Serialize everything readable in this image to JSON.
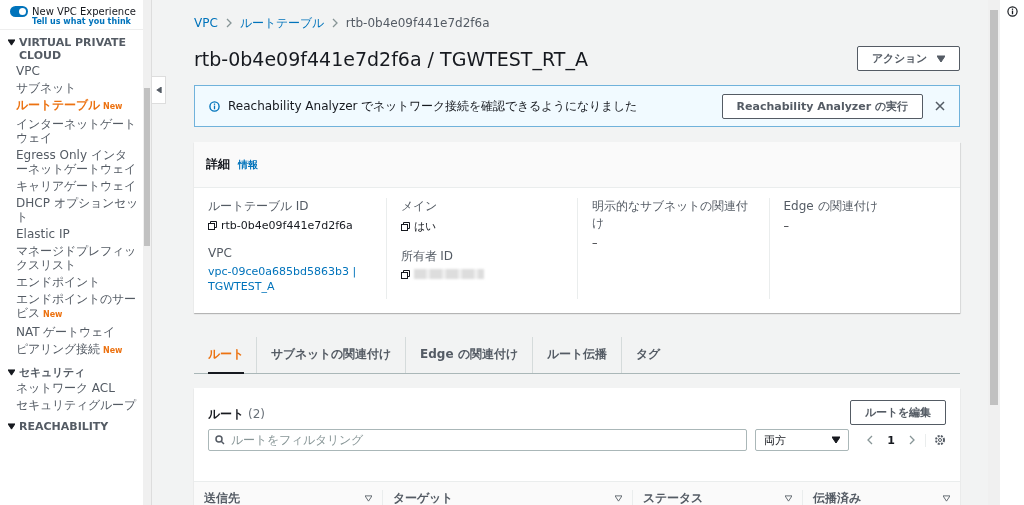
{
  "experience": {
    "label": "New VPC Experience",
    "on": true,
    "feedback": "Tell us what you think"
  },
  "sidebar": {
    "sections": [
      {
        "title": "VIRTUAL PRIVATE CLOUD",
        "expanded": true,
        "items": [
          {
            "label": "VPC",
            "selected": false
          },
          {
            "label": "サブネット",
            "selected": false
          },
          {
            "label": "ルートテーブル",
            "selected": true,
            "badge": "New"
          },
          {
            "label": "インターネットゲートウェイ",
            "selected": false
          },
          {
            "label": "Egress Only インターネットゲートウェイ",
            "selected": false
          },
          {
            "label": "キャリアゲートウェイ",
            "selected": false
          },
          {
            "label": "DHCP オプションセット",
            "selected": false
          },
          {
            "label": "Elastic IP",
            "selected": false
          },
          {
            "label": "マネージドプレフィックスリスト",
            "selected": false
          },
          {
            "label": "エンドポイント",
            "selected": false
          },
          {
            "label": "エンドポイントのサービス",
            "selected": false,
            "badge": "New"
          },
          {
            "label": "NAT ゲートウェイ",
            "selected": false
          },
          {
            "label": "ピアリング接続",
            "selected": false,
            "badge": "New"
          }
        ]
      },
      {
        "title": "セキュリティ",
        "expanded": true,
        "items": [
          {
            "label": "ネットワーク ACL",
            "selected": false
          },
          {
            "label": "セキュリティグループ",
            "selected": false
          }
        ]
      },
      {
        "title": "REACHABILITY",
        "expanded": true
      }
    ]
  },
  "breadcrumb": [
    {
      "label": "VPC",
      "link": true
    },
    {
      "label": "ルートテーブル",
      "link": true
    },
    {
      "label": "rtb-0b4e09f441e7d2f6a",
      "link": false
    }
  ],
  "title": "rtb-0b4e09f441e7d2f6a / TGWTEST_RT_A",
  "actions_button": "アクション",
  "alert": {
    "message": "Reachability Analyzer でネットワーク接続を確認できるようになりました",
    "button": "Reachability Analyzer の実行"
  },
  "details": {
    "title": "詳細",
    "info": "情報",
    "columns": [
      [
        {
          "label": "ルートテーブル ID",
          "value": "rtb-0b4e09f441e7d2f6a",
          "kind": "copy"
        },
        {
          "label": "VPC",
          "value": "vpc-09ce0a685bd5863b3 | TGWTEST_A",
          "kind": "link"
        }
      ],
      [
        {
          "label": "メイン",
          "value": "はい",
          "kind": "copy"
        },
        {
          "label": "所有者 ID",
          "kind": "redacted"
        }
      ],
      [
        {
          "label": "明示的なサブネットの関連付け",
          "value": "–",
          "kind": "plain"
        }
      ],
      [
        {
          "label": "Edge の関連付け",
          "value": "–",
          "kind": "plain"
        }
      ]
    ]
  },
  "tabs": [
    {
      "label": "ルート",
      "selected": true
    },
    {
      "label": "サブネットの関連付け",
      "selected": false
    },
    {
      "label": "Edge の関連付け",
      "selected": false
    },
    {
      "label": "ルート伝播",
      "selected": false
    },
    {
      "label": "タグ",
      "selected": false
    }
  ],
  "routes": {
    "title": "ルート",
    "count": "(2)",
    "edit_button": "ルートを編集",
    "filter_placeholder": "ルートをフィルタリング",
    "direction": "両方",
    "page": "1",
    "columns": [
      "送信先",
      "ターゲット",
      "ステータス",
      "伝播済み"
    ]
  }
}
